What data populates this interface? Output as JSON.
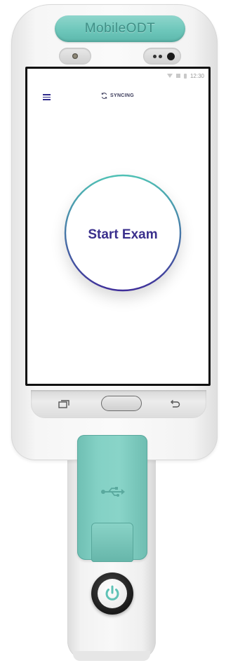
{
  "device": {
    "brand_text": "MobileODT",
    "accent_color": "#6ec7bb",
    "handle_clip_icon": "usb-icon",
    "power_icon": "power-icon"
  },
  "status_bar": {
    "time": "12:30",
    "icons": [
      "wifi-icon",
      "signal-icon",
      "battery-icon"
    ]
  },
  "app_bar": {
    "menu_icon": "hamburger-menu-icon",
    "sync_icon": "sync-icon",
    "sync_label": "SYNCING"
  },
  "main": {
    "start_button_label": "Start Exam",
    "button_ring_colors": [
      "#4fc1b5",
      "#3f2f9a"
    ]
  },
  "nav_bar": {
    "items": [
      "recent-apps-button",
      "home-button",
      "back-button"
    ]
  }
}
